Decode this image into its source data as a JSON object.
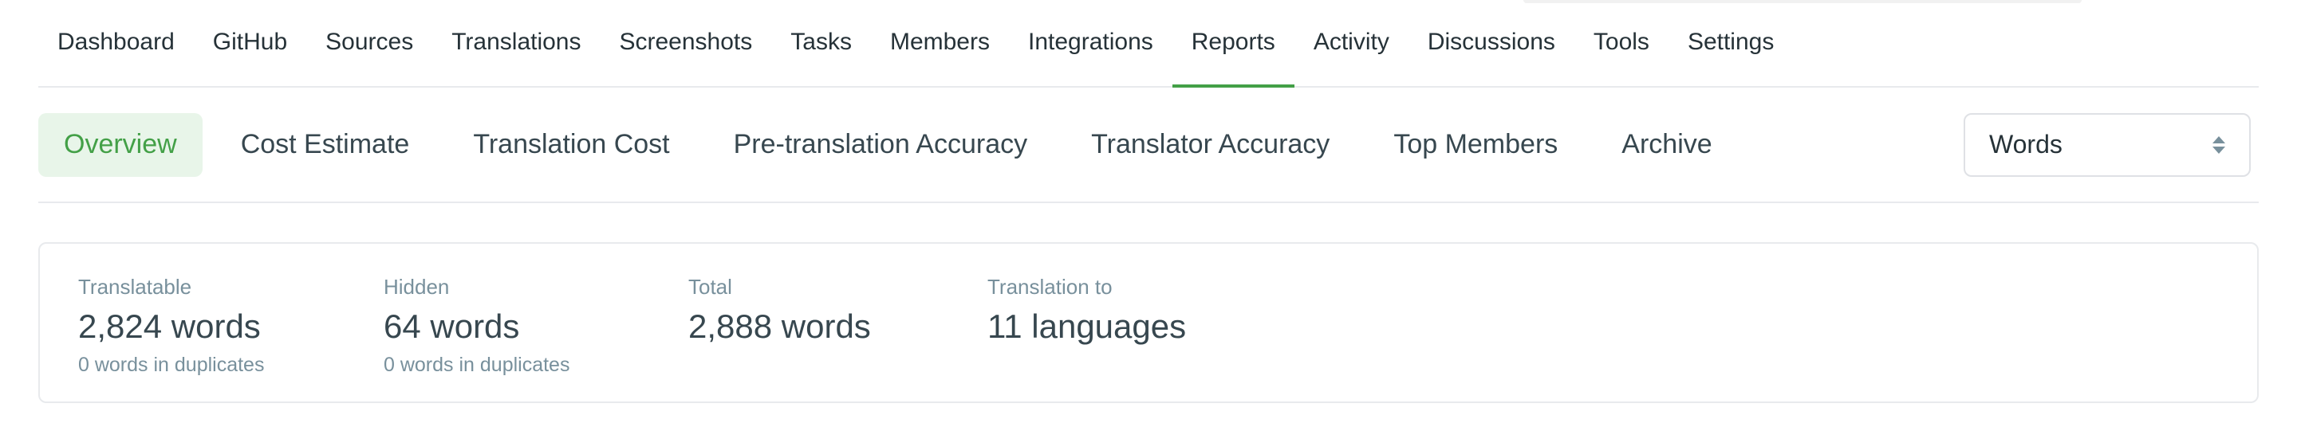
{
  "top_nav": {
    "items": [
      {
        "label": "Dashboard"
      },
      {
        "label": "GitHub"
      },
      {
        "label": "Sources"
      },
      {
        "label": "Translations"
      },
      {
        "label": "Screenshots"
      },
      {
        "label": "Tasks"
      },
      {
        "label": "Members"
      },
      {
        "label": "Integrations"
      },
      {
        "label": "Reports",
        "active": true
      },
      {
        "label": "Activity"
      },
      {
        "label": "Discussions"
      },
      {
        "label": "Tools"
      },
      {
        "label": "Settings"
      }
    ]
  },
  "sub_nav": {
    "tabs": [
      {
        "label": "Overview",
        "active": true
      },
      {
        "label": "Cost Estimate"
      },
      {
        "label": "Translation Cost"
      },
      {
        "label": "Pre-translation Accuracy"
      },
      {
        "label": "Translator Accuracy"
      },
      {
        "label": "Top Members"
      },
      {
        "label": "Archive"
      }
    ],
    "unit_select": {
      "value": "Words"
    }
  },
  "stats": {
    "translatable": {
      "label": "Translatable",
      "value": "2,824 words",
      "sub": "0 words in duplicates"
    },
    "hidden": {
      "label": "Hidden",
      "value": "64 words",
      "sub": "0 words in duplicates"
    },
    "total": {
      "label": "Total",
      "value": "2,888 words"
    },
    "languages": {
      "label": "Translation to",
      "value": "11 languages"
    }
  },
  "colors": {
    "accent": "#43a047",
    "active_tab_bg": "#e8f5e9",
    "border": "#e8eaed",
    "muted_text": "#78909c"
  }
}
